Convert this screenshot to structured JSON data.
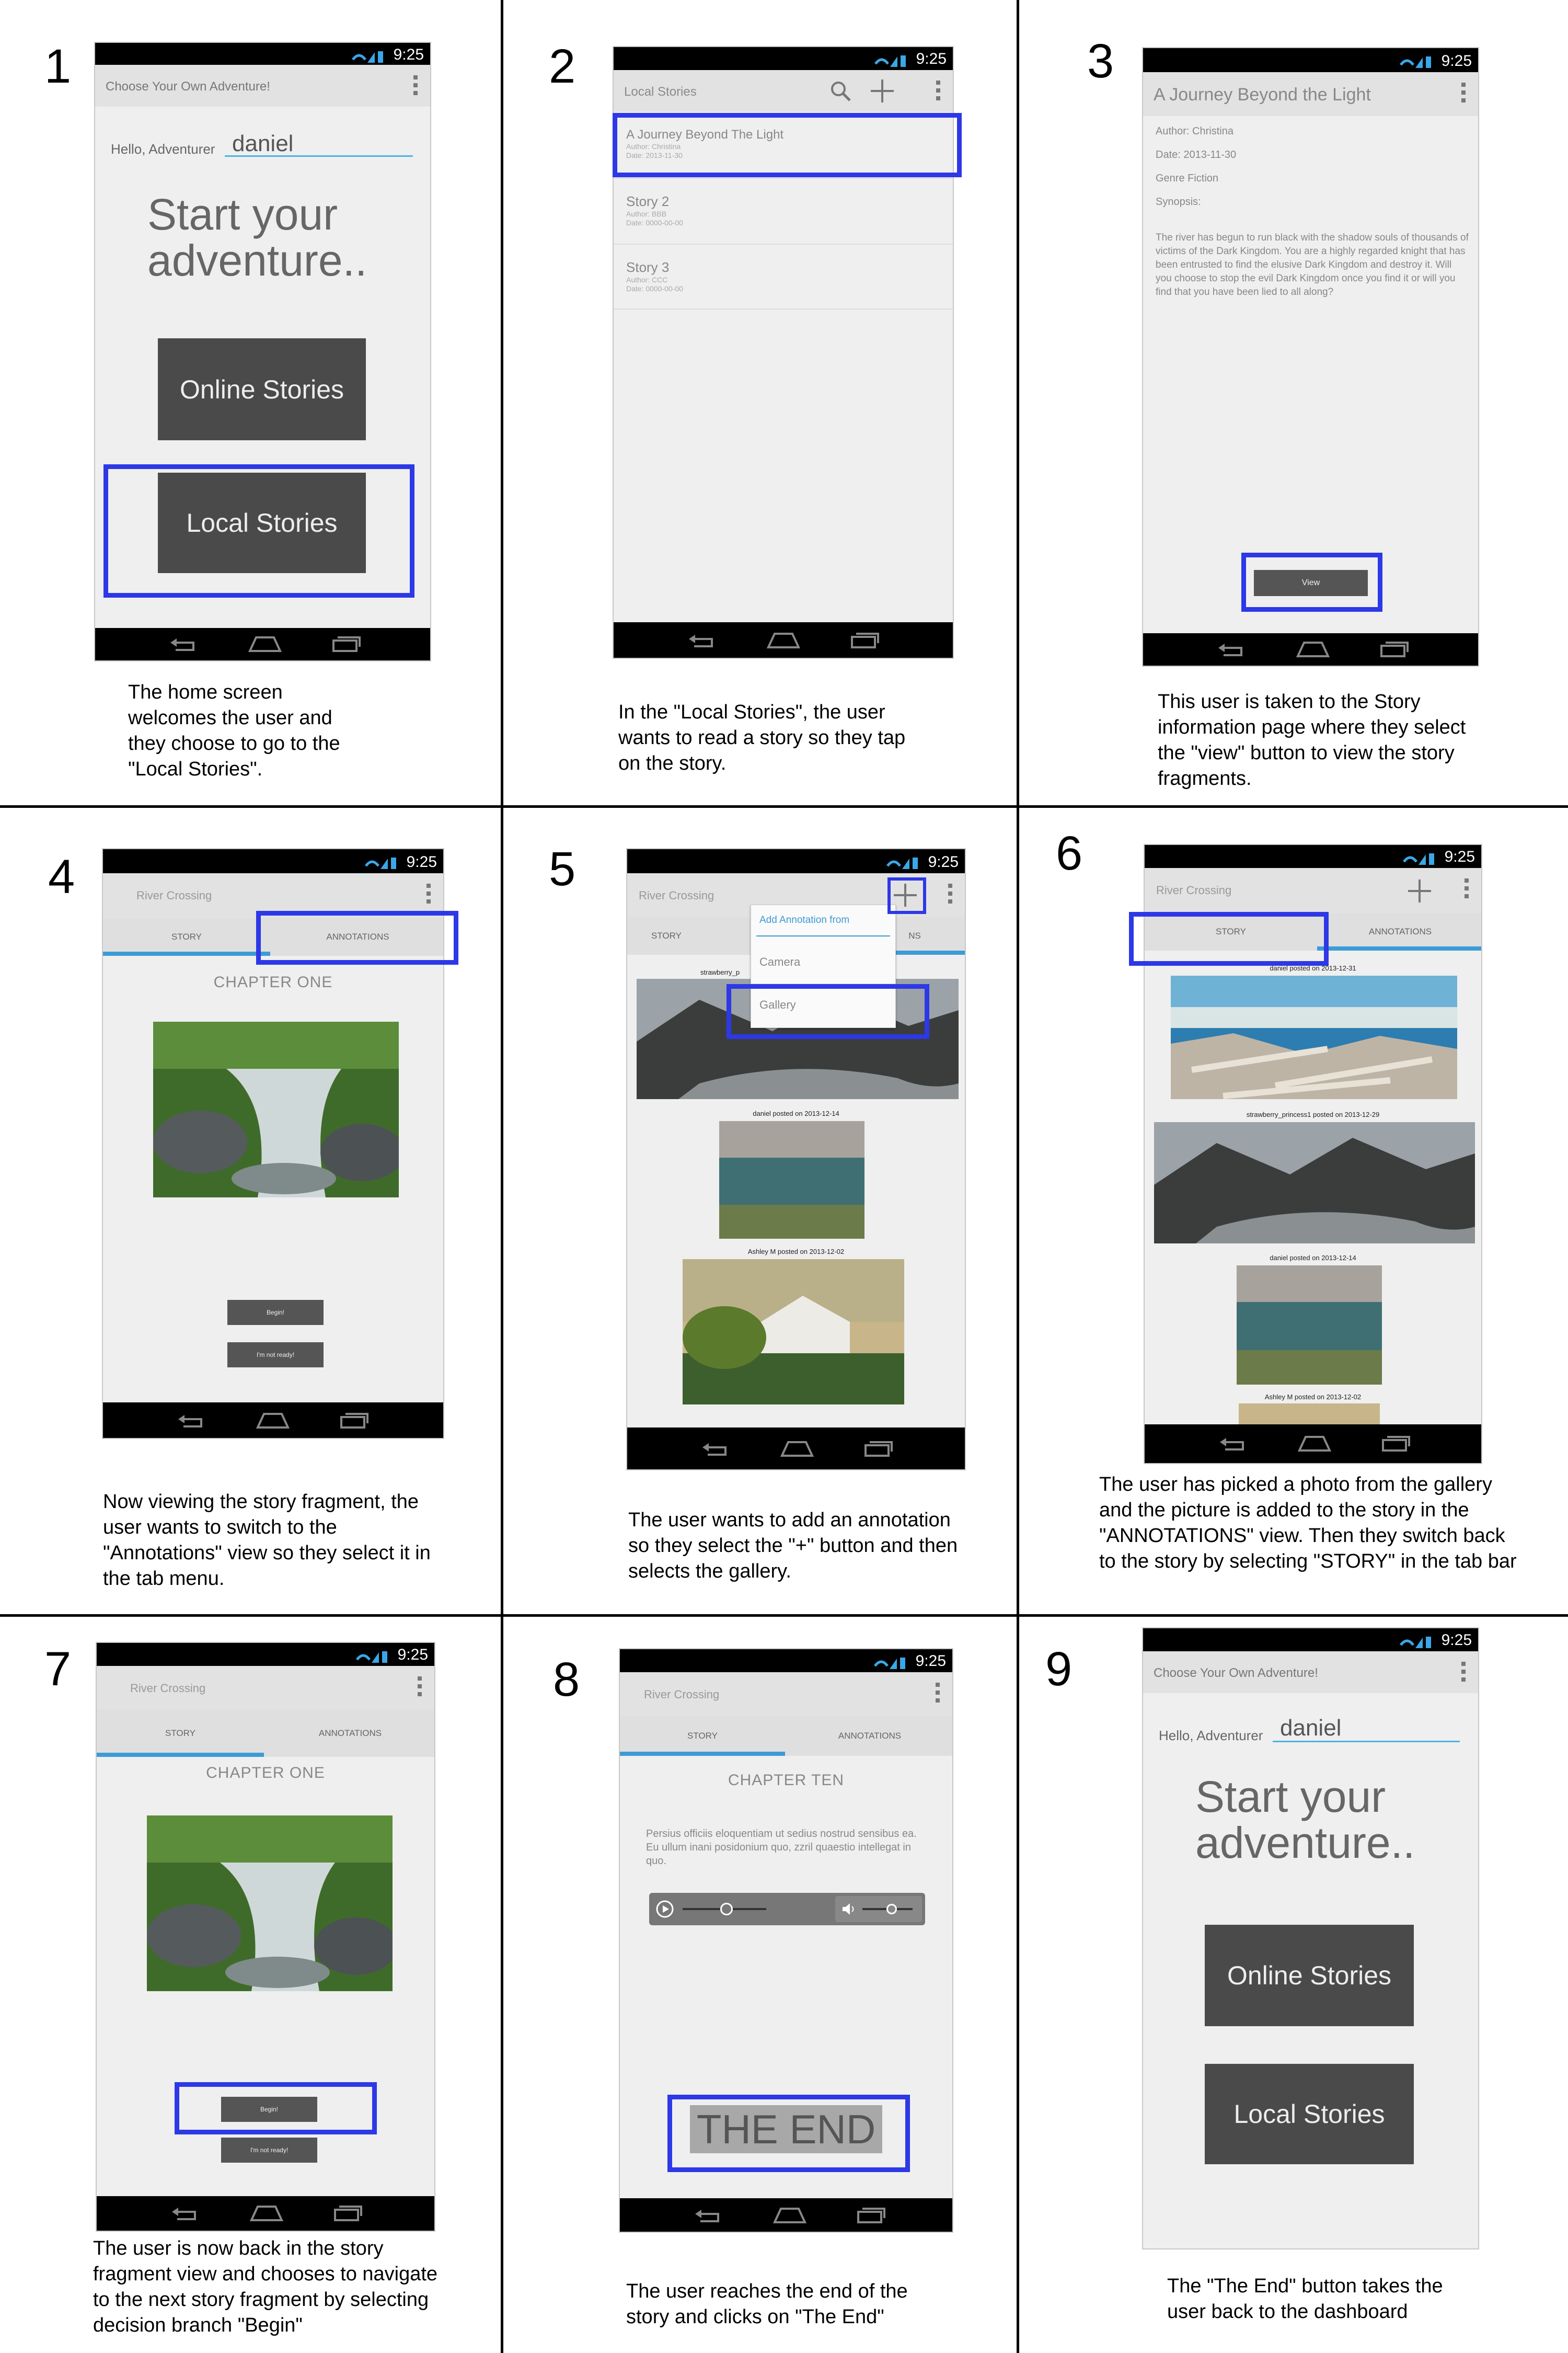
{
  "status_bar": {
    "time": "9:25"
  },
  "steps": [
    {
      "num": "1",
      "caption": "The home screen welcomes the user and they choose to go to the \"Local Stories\"."
    },
    {
      "num": "2",
      "caption": "In the \"Local Stories\", the user wants to read a story so they tap on the story."
    },
    {
      "num": "3",
      "caption": "This user is taken to the Story information page where they select the \"view\" button to view the story fragments."
    },
    {
      "num": "4",
      "caption": "Now viewing the story fragment, the user wants to switch to the \"Annotations\" view so they select it in the tab menu."
    },
    {
      "num": "5",
      "caption": "The user wants to add an annotation so they select the \"+\" button and then selects the gallery."
    },
    {
      "num": "6",
      "caption": "The user has picked a photo from the gallery and the picture is added to the story in the \"ANNOTATIONS\" view. Then they switch back to the story by selecting \"STORY\" in the tab bar"
    },
    {
      "num": "7",
      "caption": "The user is now back in the story fragment view and chooses to navigate to the next story fragment by selecting decision branch \"Begin\""
    },
    {
      "num": "8",
      "caption": "The user reaches the end of the story and clicks on \"The End\""
    },
    {
      "num": "9",
      "caption": "The \"The End\" button takes the user back to the dashboard"
    }
  ],
  "home": {
    "app_title": "Choose Your Own Adventure!",
    "greeting": "Hello, Adventurer",
    "username": "daniel",
    "headline_1": "Start your",
    "headline_2": "adventure..",
    "online_button": "Online Stories",
    "local_button": "Local Stories"
  },
  "local_stories": {
    "title": "Local Stories",
    "items": [
      {
        "title": "A Journey Beyond The Light",
        "author": "Author: Christina",
        "date": "Date: 2013-11-30"
      },
      {
        "title": "Story 2",
        "author": "Author: BBB",
        "date": "Date: 0000-00-00"
      },
      {
        "title": "Story 3",
        "author": "Author: CCC",
        "date": "Date: 0000-00-00"
      }
    ]
  },
  "story_info": {
    "title": "A Journey Beyond the Light",
    "author": "Author: Christina",
    "date": "Date: 2013-11-30",
    "genre": "Genre Fiction",
    "synopsis_label": "Synopsis:",
    "synopsis": "The river has begun to run black with the shadow souls of thousands of victims of the Dark Kingdom. You are a highly regarded knight that has been entrusted to find the elusive Dark Kingdom and destroy it. Will you choose to stop the evil Dark Kingdom once you find it or will you find that you have been lied to all along?",
    "view_button": "View"
  },
  "fragment": {
    "title": "River Crossing",
    "tab_story": "STORY",
    "tab_annotations": "ANNOTATIONS",
    "chapter": "CHAPTER ONE",
    "begin_button": "Begin!",
    "not_ready_button": "I'm not ready!"
  },
  "annotation_menu": {
    "header": "Add Annotation from",
    "camera": "Camera",
    "gallery": "Gallery"
  },
  "annotations": {
    "partial_user": "strawberry_p",
    "partial_tab": "NS",
    "posts": [
      {
        "label": "daniel posted on 2013-12-31"
      },
      {
        "label": "strawberry_princess1 posted on 2013-12-29"
      },
      {
        "label": "daniel posted on 2013-12-14"
      },
      {
        "label": "Ashley M posted on 2013-12-02"
      }
    ]
  },
  "ending": {
    "chapter": "CHAPTER TEN",
    "text": "Persius officiis eloquentiam ut sedius nostrud sensibus ea. Eu ullum inani posidonium quo, zzril quaestio intellegat in quo.",
    "end_button": "THE END"
  },
  "colors": {
    "highlight": "#2d38e6",
    "tab_underline": "#3d9bd6",
    "button_dark": "#4a4a4a"
  }
}
